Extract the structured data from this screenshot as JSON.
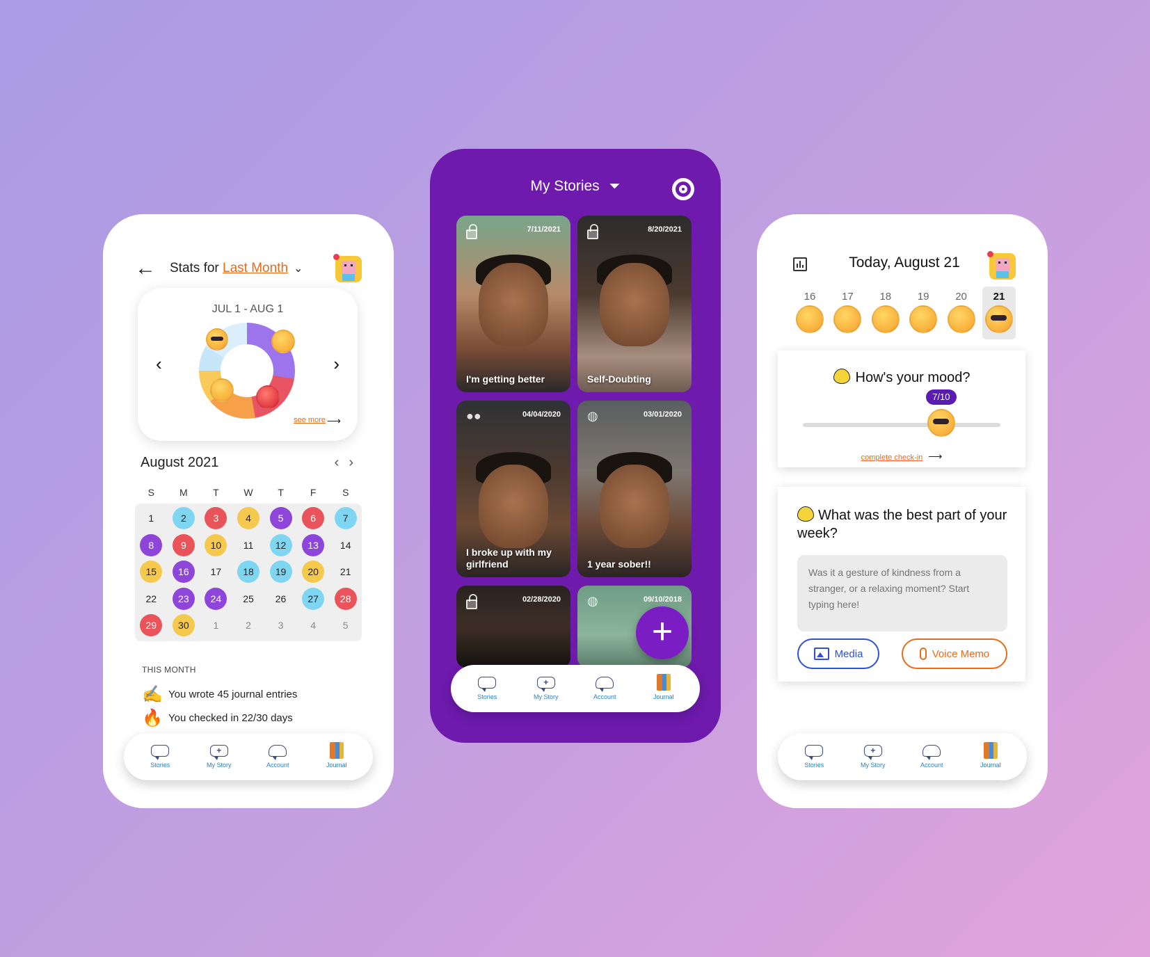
{
  "colors": {
    "accent_orange": "#ea6a1a",
    "purple": "#6d1aad",
    "blue_link": "#2f4fd6"
  },
  "nav": {
    "items": [
      {
        "label": "Stories",
        "icon": "speech-bubble-icon"
      },
      {
        "label": "My Story",
        "icon": "add-story-icon"
      },
      {
        "label": "Account",
        "icon": "account-icon"
      },
      {
        "label": "Journal",
        "icon": "journal-icon"
      }
    ]
  },
  "stats": {
    "title_prefix": "Stats for",
    "period": "Last Month",
    "range": "JUL 1 - AUG 1",
    "see_more": "see more",
    "calendar": {
      "month": "August 2021",
      "weekdays": [
        "S",
        "M",
        "T",
        "W",
        "T",
        "F",
        "S"
      ],
      "days": [
        {
          "d": "1",
          "mood": "none"
        },
        {
          "d": "2",
          "mood": "blue"
        },
        {
          "d": "3",
          "mood": "red"
        },
        {
          "d": "4",
          "mood": "yellow"
        },
        {
          "d": "5",
          "mood": "purple"
        },
        {
          "d": "6",
          "mood": "red"
        },
        {
          "d": "7",
          "mood": "blue"
        },
        {
          "d": "8",
          "mood": "purple"
        },
        {
          "d": "9",
          "mood": "red"
        },
        {
          "d": "10",
          "mood": "yellow"
        },
        {
          "d": "11",
          "mood": "none"
        },
        {
          "d": "12",
          "mood": "blue"
        },
        {
          "d": "13",
          "mood": "purple"
        },
        {
          "d": "14",
          "mood": "none"
        },
        {
          "d": "15",
          "mood": "yellow"
        },
        {
          "d": "16",
          "mood": "purple"
        },
        {
          "d": "17",
          "mood": "none"
        },
        {
          "d": "18",
          "mood": "blue"
        },
        {
          "d": "19",
          "mood": "blue"
        },
        {
          "d": "20",
          "mood": "yellow"
        },
        {
          "d": "21",
          "mood": "none"
        },
        {
          "d": "22",
          "mood": "none"
        },
        {
          "d": "23",
          "mood": "purple"
        },
        {
          "d": "24",
          "mood": "purple"
        },
        {
          "d": "25",
          "mood": "none"
        },
        {
          "d": "26",
          "mood": "none"
        },
        {
          "d": "27",
          "mood": "blue"
        },
        {
          "d": "28",
          "mood": "red"
        },
        {
          "d": "29",
          "mood": "red"
        },
        {
          "d": "30",
          "mood": "yellow"
        },
        {
          "d": "1",
          "mood": "muted"
        },
        {
          "d": "2",
          "mood": "muted"
        },
        {
          "d": "3",
          "mood": "muted"
        },
        {
          "d": "4",
          "mood": "muted"
        },
        {
          "d": "5",
          "mood": "muted"
        }
      ]
    },
    "this_month_label": "THIS MONTH",
    "line1_emoji": "✍",
    "line1": "You wrote 45 journal entries",
    "line2_emoji": "🔥",
    "line2": "You checked in 22/30 days"
  },
  "stories": {
    "title": "My Stories",
    "tiles": [
      {
        "date": "7/11/2021",
        "caption": "I'm getting better",
        "privacy": "lock-icon"
      },
      {
        "date": "8/20/2021",
        "caption": "Self-Doubting",
        "privacy": "lock-icon"
      },
      {
        "date": "04/04/2020",
        "caption": "I broke up with my girlfriend",
        "privacy": "group-icon"
      },
      {
        "date": "03/01/2020",
        "caption": "1 year sober!!",
        "privacy": "globe-icon"
      },
      {
        "date": "02/28/2020",
        "caption": "",
        "privacy": "lock-icon"
      },
      {
        "date": "09/10/2018",
        "caption": "",
        "privacy": "globe-icon"
      }
    ],
    "fab_label": "+"
  },
  "today": {
    "title": "Today, August 21",
    "week": [
      {
        "n": "16",
        "mood": "worried"
      },
      {
        "n": "17",
        "mood": "sad"
      },
      {
        "n": "18",
        "mood": "grinning"
      },
      {
        "n": "19",
        "mood": "pensive"
      },
      {
        "n": "20",
        "mood": "crying"
      },
      {
        "n": "21",
        "mood": "cool",
        "selected": true
      }
    ],
    "mood_question": "How's your mood?",
    "mood_value": "7/10",
    "mood_fraction": 0.7,
    "checkin_link": "complete check-in",
    "prompt": "What was the best part of your week?",
    "prompt_placeholder": "Was it a gesture of kindness from a stranger, or a relaxing moment? Start typing here!",
    "media_label": "Media",
    "voice_label": "Voice Memo"
  }
}
